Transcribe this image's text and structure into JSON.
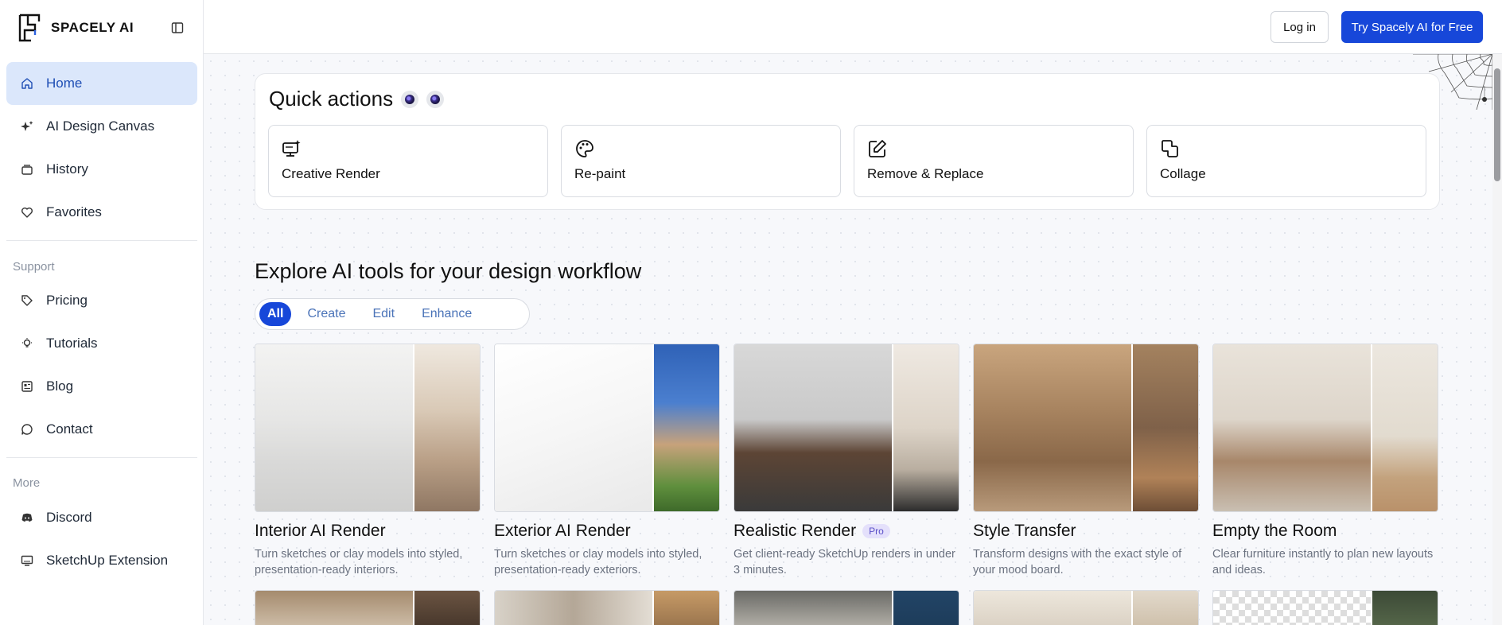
{
  "brand": {
    "name": "SPACELY AI"
  },
  "nav": {
    "main": [
      {
        "label": "Home",
        "icon": "home-icon",
        "active": true
      },
      {
        "label": "AI Design Canvas",
        "icon": "sparkles-icon"
      },
      {
        "label": "History",
        "icon": "history-icon"
      },
      {
        "label": "Favorites",
        "icon": "heart-icon"
      }
    ],
    "support_label": "Support",
    "support": [
      {
        "label": "Pricing",
        "icon": "tag-icon"
      },
      {
        "label": "Tutorials",
        "icon": "lightbulb-icon"
      },
      {
        "label": "Blog",
        "icon": "newspaper-icon"
      },
      {
        "label": "Contact",
        "icon": "chat-icon"
      }
    ],
    "more_label": "More",
    "more": [
      {
        "label": "Discord",
        "icon": "discord-icon"
      },
      {
        "label": "SketchUp Extension",
        "icon": "monitor-icon"
      }
    ]
  },
  "topbar": {
    "login": "Log in",
    "try": "Try Spacely AI for Free"
  },
  "quick_actions": {
    "title": "Quick actions",
    "items": [
      {
        "label": "Creative Render",
        "icon": "render-icon"
      },
      {
        "label": "Re-paint",
        "icon": "palette-icon"
      },
      {
        "label": "Remove & Replace",
        "icon": "edit-icon"
      },
      {
        "label": "Collage",
        "icon": "collage-icon"
      }
    ]
  },
  "explore": {
    "title": "Explore AI tools for your design workflow",
    "filters": [
      "All",
      "Create",
      "Edit",
      "Enhance"
    ],
    "active_filter": "All",
    "tools": [
      {
        "title": "Interior AI Render",
        "desc": "Turn sketches or clay models into styled, presentation-ready interiors.",
        "badge": ""
      },
      {
        "title": "Exterior AI Render",
        "desc": "Turn sketches or clay models into styled, presentation-ready exteriors.",
        "badge": ""
      },
      {
        "title": "Realistic Render",
        "desc": "Get client-ready SketchUp renders in under 3 minutes.",
        "badge": "Pro"
      },
      {
        "title": "Style Transfer",
        "desc": "Transform designs with the exact style of your mood board.",
        "badge": ""
      },
      {
        "title": "Empty the Room",
        "desc": "Clear furniture instantly to plan new layouts and ideas.",
        "badge": ""
      }
    ]
  },
  "colors": {
    "accent": "#1747d9",
    "active_nav_bg": "#dbe7fb",
    "pro_badge": "#e4e0fb"
  }
}
